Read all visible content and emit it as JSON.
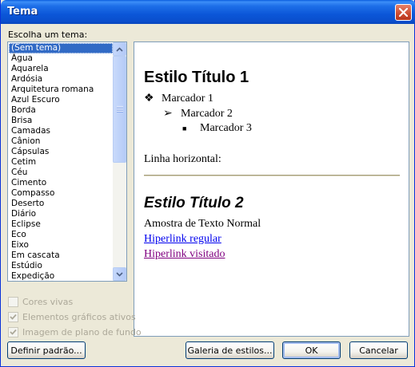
{
  "window": {
    "title": "Tema"
  },
  "theme_list": {
    "label": "Escolha um tema:",
    "selected": "(Sem tema)",
    "items": [
      "(Sem tema)",
      "Água",
      "Aquarela",
      "Ardósia",
      "Arquitetura romana",
      "Azul Escuro",
      "Borda",
      "Brisa",
      "Camadas",
      "Cânion",
      "Cápsulas",
      "Cetim",
      "Céu",
      "Cimento",
      "Compasso",
      "Deserto",
      "Diário",
      "Eclipse",
      "Eco",
      "Eixo",
      "Em cascata",
      "Estúdio",
      "Expedição"
    ]
  },
  "preview": {
    "heading1": "Estilo Título 1",
    "bullet1": "Marcador 1",
    "bullet2": "Marcador 2",
    "bullet3": "Marcador 3",
    "hr_label": "Linha horizontal:",
    "heading2": "Estilo Título 2",
    "normal_text": "Amostra de Texto Normal",
    "link_regular": "Hiperlink regular",
    "link_visited": "Hiperlink visitado"
  },
  "options": {
    "vivid_colors": {
      "label": "Cores vivas",
      "checked": false
    },
    "active_graphics": {
      "label": "Elementos gráficos ativos",
      "checked": true
    },
    "background_image": {
      "label": "Imagem de plano de fundo",
      "checked": true
    }
  },
  "buttons": {
    "set_default": "Definir padrão...",
    "style_gallery": "Galeria de estilos...",
    "ok": "OK",
    "cancel": "Cancelar"
  }
}
